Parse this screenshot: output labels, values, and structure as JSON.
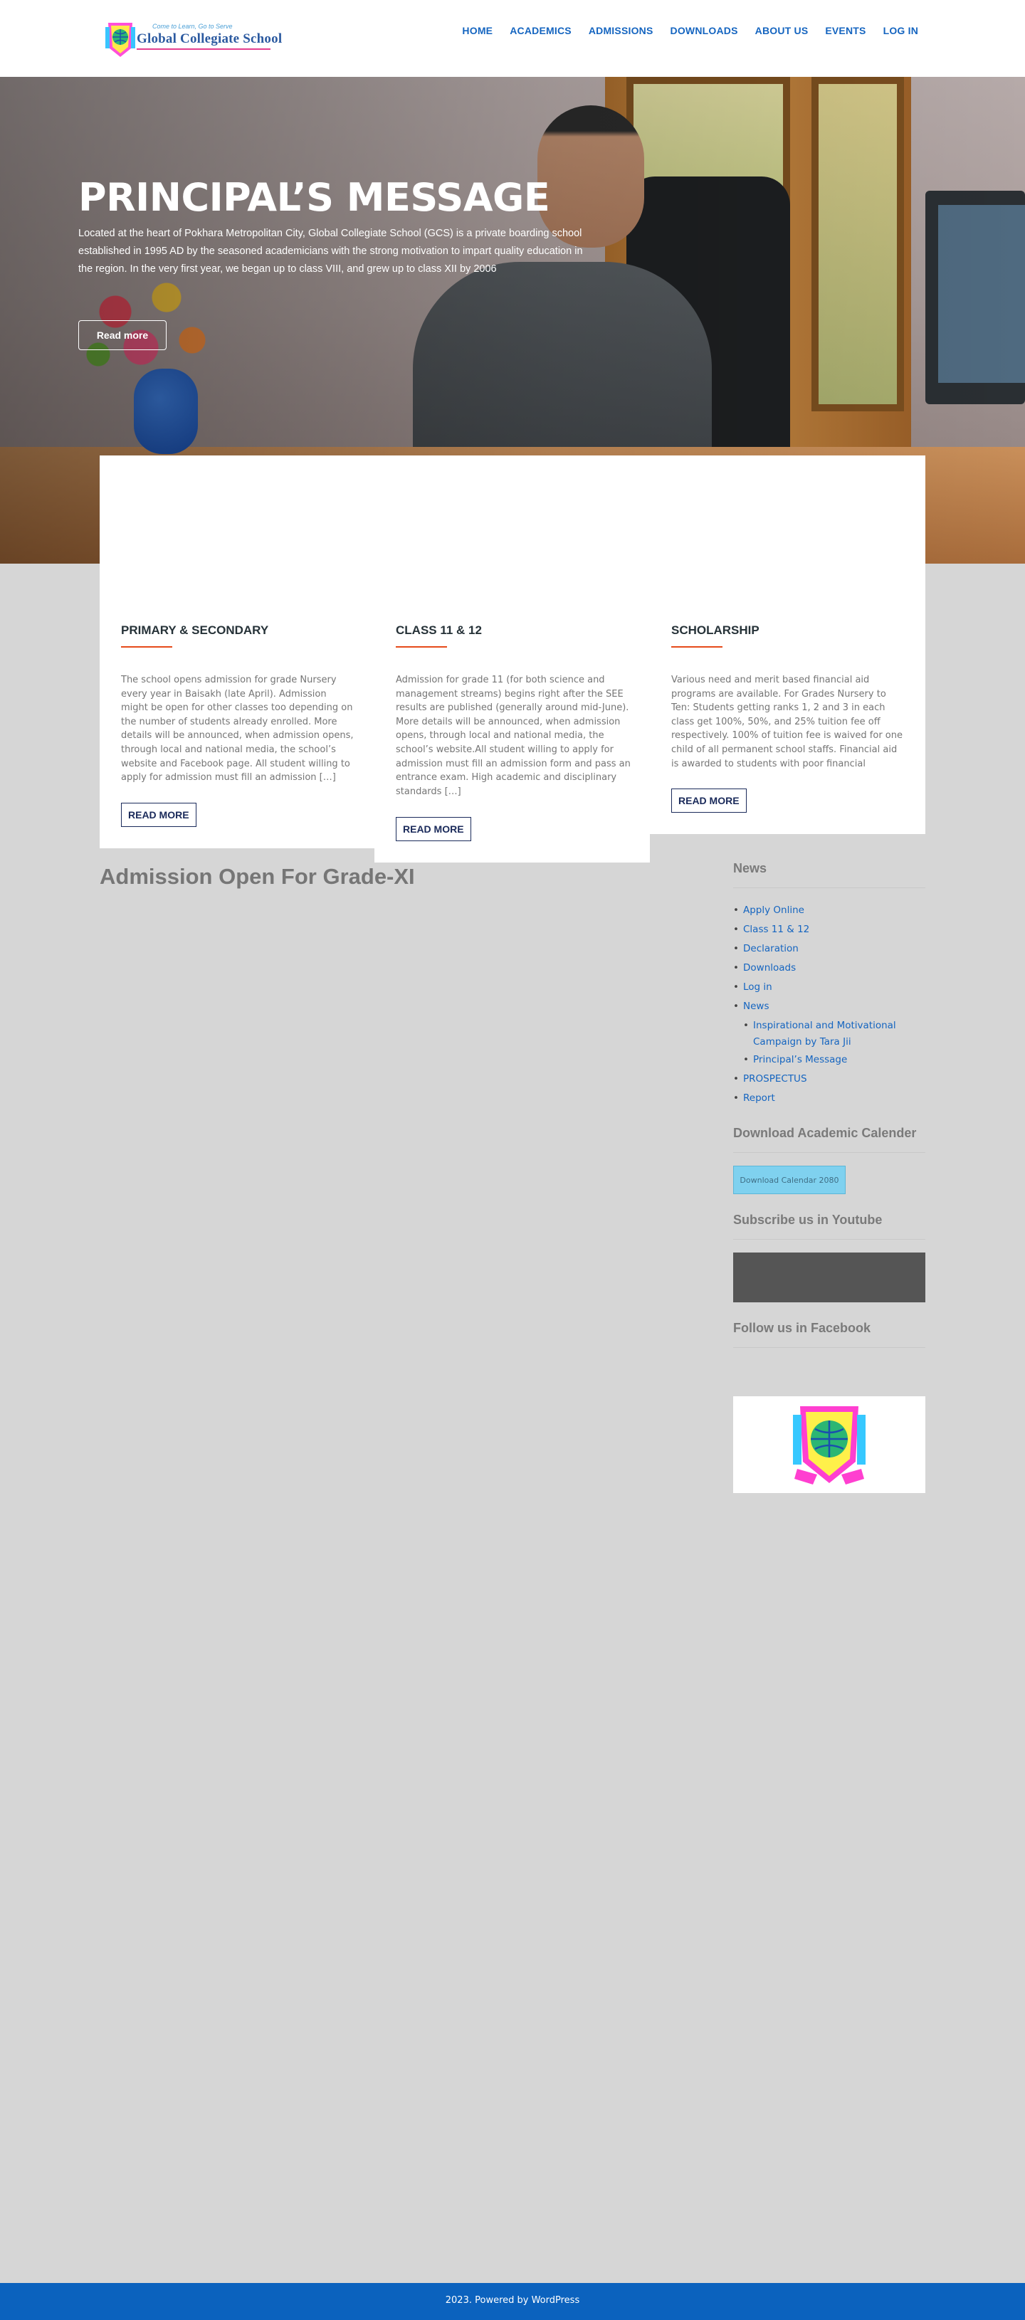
{
  "header": {
    "logo": {
      "tagline": "Come to Learn, Go to Serve",
      "name": "Global Collegiate School"
    },
    "nav": [
      "HOME",
      "ACADEMICS",
      "ADMISSIONS",
      "DOWNLOADS",
      "ABOUT US",
      "EVENTS",
      "LOG IN"
    ]
  },
  "hero": {
    "title": "PRINCIPAL’S MESSAGE",
    "text": "Located at the heart of Pokhara Metropolitan City, Global Collegiate School (GCS) is a private boarding school established in 1995 AD by the seasoned academicians with the strong motivation to impart quality education in the region. In the very first year, we began up to class VIII, and grew up to class XII by 2006",
    "button": "Read more"
  },
  "features": [
    {
      "title": "PRIMARY & SECONDARY",
      "text": "The school opens admission for grade Nursery every year in Baisakh (late April). Admission might be open for other classes too depending on the number of students already enrolled. More details will be announced, when admission opens, through local and national media, the school’s website and  Facebook page. All student willing to apply for admission must fill an admission […]",
      "button": "READ MORE"
    },
    {
      "title": "CLASS 11 & 12",
      "text": "Admission for grade 11 (for both science and management streams) begins right after the SEE results are published (generally around mid-June). More details will be announced, when admission opens, through local and national media, the school’s website.All student willing to apply for admission must fill an admission form and pass an entrance exam. High academic and disciplinary standards […]",
      "button": "READ MORE"
    },
    {
      "title": "SCHOLARSHIP",
      "text": "Various need and merit based financial aid programs are available. For Grades Nursery to Ten: Students getting ranks 1, 2 and 3 in each class get 100%, 50%, and 25% tuition fee off respectively. 100% of tuition fee is waived for one child of all permanent school staffs. Financial aid is awarded to students with poor financial",
      "button": "READ MORE"
    }
  ],
  "main": {
    "post_title": "Admission Open For Grade-XI"
  },
  "sidebar": {
    "news": {
      "title": "News",
      "items": [
        {
          "label": "Apply Online",
          "level": 0
        },
        {
          "label": "Class 11 & 12",
          "level": 0
        },
        {
          "label": "Declaration",
          "level": 0
        },
        {
          "label": "Downloads",
          "level": 0
        },
        {
          "label": "Log in",
          "level": 0
        },
        {
          "label": "News",
          "level": 0
        },
        {
          "label": "Inspirational and Motivational Campaign by Tara Jii",
          "level": 1
        },
        {
          "label": "Principal’s Message",
          "level": 1
        },
        {
          "label": "PROSPECTUS",
          "level": 0
        },
        {
          "label": "Report",
          "level": 0
        }
      ]
    },
    "calendar": {
      "title": "Download Academic Calender",
      "button": "Download Calendar 2080"
    },
    "youtube": {
      "title": "Subscribe us in Youtube"
    },
    "facebook": {
      "title": "Follow us in Facebook"
    }
  },
  "footer": {
    "text": "2023. Powered by WordPress"
  },
  "colors": {
    "nav_link": "#1565c0",
    "accent_line": "#e64a19",
    "footer_bg": "#0b62be",
    "page_bg": "#d6d6d6"
  }
}
